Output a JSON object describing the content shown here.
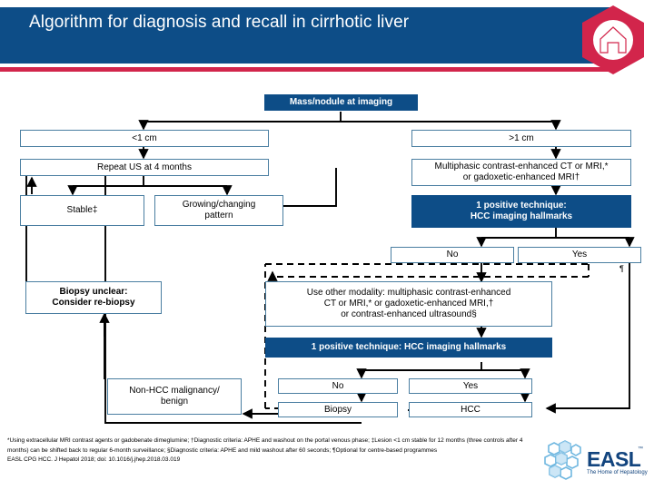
{
  "header": {
    "title": "Algorithm for diagnosis and recall in cirrhotic liver",
    "bar_color": "#0d4d87",
    "accent_color": "#d2254b",
    "logo_icon": "easl-hexagon-house-icon"
  },
  "chart_data": {
    "type": "diagram",
    "title": "Algorithm for diagnosis and recall in cirrhotic liver",
    "nodes": [
      {
        "id": "mass",
        "label": "Mass/nodule at imaging",
        "style": "dark"
      },
      {
        "id": "lt1cm",
        "label": "<1 cm",
        "style": "plain"
      },
      {
        "id": "gt1cm",
        "label": ">1 cm",
        "style": "plain"
      },
      {
        "id": "repeat_us",
        "label": "Repeat US at 4 months",
        "style": "plain"
      },
      {
        "id": "multiphasic",
        "label": "Multiphasic contrast-enhanced CT or MRI,* or gadoxetic-enhanced MRI†",
        "style": "plain"
      },
      {
        "id": "stable",
        "label": "Stable‡",
        "style": "plain"
      },
      {
        "id": "growing",
        "label": "Growing/changing pattern",
        "style": "plain"
      },
      {
        "id": "pos1",
        "label": "1 positive technique: HCC imaging hallmarks",
        "style": "dark"
      },
      {
        "id": "no1",
        "label": "No",
        "style": "plain"
      },
      {
        "id": "yes1",
        "label": "Yes",
        "style": "plain"
      },
      {
        "id": "biopsy_unclear",
        "label": "Biopsy unclear: Consider re-biopsy",
        "style": "bold"
      },
      {
        "id": "other_modality",
        "label": "Use other modality: multiphasic contrast-enhanced CT or MRI,* or gadoxetic-enhanced MRI,† or contrast-enhanced ultrasound§",
        "style": "plain"
      },
      {
        "id": "pos2",
        "label": "1 positive technique: HCC imaging hallmarks",
        "style": "dark"
      },
      {
        "id": "nonhcc",
        "label": "Non-HCC malignancy/ benign",
        "style": "plain"
      },
      {
        "id": "no2",
        "label": "No",
        "style": "plain"
      },
      {
        "id": "yes2",
        "label": "Yes",
        "style": "plain"
      },
      {
        "id": "biopsy",
        "label": "Biopsy",
        "style": "plain"
      },
      {
        "id": "hcc",
        "label": "HCC",
        "style": "plain"
      }
    ],
    "edges": [
      {
        "from": "mass",
        "to": "lt1cm",
        "style": "solid"
      },
      {
        "from": "mass",
        "to": "gt1cm",
        "style": "solid"
      },
      {
        "from": "lt1cm",
        "to": "repeat_us",
        "style": "solid"
      },
      {
        "from": "gt1cm",
        "to": "multiphasic",
        "style": "solid"
      },
      {
        "from": "repeat_us",
        "to": "stable",
        "style": "solid"
      },
      {
        "from": "repeat_us",
        "to": "growing",
        "style": "solid"
      },
      {
        "from": "stable",
        "to": "repeat_us",
        "style": "solid"
      },
      {
        "from": "growing",
        "to": "multiphasic",
        "style": "solid"
      },
      {
        "from": "multiphasic",
        "to": "pos1",
        "style": "solid"
      },
      {
        "from": "pos1",
        "to": "no1",
        "style": "solid"
      },
      {
        "from": "pos1",
        "to": "yes1",
        "style": "solid"
      },
      {
        "from": "no1",
        "to": "other_modality",
        "style": "solid"
      },
      {
        "from": "other_modality",
        "to": "pos2",
        "style": "solid"
      },
      {
        "from": "pos2",
        "to": "no2",
        "style": "solid"
      },
      {
        "from": "pos2",
        "to": "yes2",
        "style": "solid"
      },
      {
        "from": "no2",
        "to": "biopsy",
        "style": "solid"
      },
      {
        "from": "biopsy",
        "to": "hcc",
        "style": "solid"
      },
      {
        "from": "biopsy",
        "to": "nonhcc",
        "style": "solid"
      },
      {
        "from": "yes2",
        "to": "hcc",
        "style": "solid"
      },
      {
        "from": "yes1",
        "to": "hcc",
        "style": "solid"
      },
      {
        "from": "nonhcc",
        "to": "biopsy_unclear",
        "style": "solid"
      },
      {
        "from": "biopsy_unclear",
        "to": "repeat_us",
        "style": "solid"
      },
      {
        "from": "biopsy",
        "to": "other_modality",
        "style": "dashed"
      }
    ]
  },
  "nodes": {
    "mass": "Mass/nodule at imaging",
    "lt1cm": "<1 cm",
    "gt1cm": ">1 cm",
    "repeat_us": "Repeat US at 4 months",
    "multiphasic_line1": "Multiphasic contrast-enhanced CT or MRI,*",
    "multiphasic_line2": "or gadoxetic-enhanced MRI†",
    "stable": "Stable‡",
    "growing_line1": "Growing/changing",
    "growing_line2": "pattern",
    "pos1_line1": "1 positive technique:",
    "pos1_line2": "HCC imaging hallmarks",
    "no1": "No",
    "yes1": "Yes",
    "yes1_marker": "¶",
    "biopsy_unclear_line1": "Biopsy unclear:",
    "biopsy_unclear_line2": "Consider re-biopsy",
    "other_modality_line1": "Use other modality: multiphasic contrast-enhanced",
    "other_modality_line2": "CT or MRI,* or gadoxetic-enhanced MRI,†",
    "other_modality_line3": "or contrast-enhanced ultrasound§",
    "pos2": "1 positive technique: HCC imaging hallmarks",
    "nonhcc_line1": "Non-HCC malignancy/",
    "nonhcc_line2": "benign",
    "no2": "No",
    "yes2": "Yes",
    "biopsy": "Biopsy",
    "hcc": "HCC"
  },
  "footnotes": {
    "text": "*Using extracellular MRI contrast agents or gadobenate dimeglumine; †Diagnostic criteria: APHE and washout on the portal venous phase; ‡Lesion <1 cm stable for 12 months (three controls after 4 months) can be shifted back to regular 6-month surveillance; §Diagnostic criteria: APHE and mild washout after 60 seconds; ¶Optional for centre-based programmes",
    "citation": "EASL CPG HCC. J Hepatol 2018; doi: 10.1016/j.jhep.2018.03.019"
  },
  "easl_logo": {
    "wordmark": "EASL",
    "tm": "™",
    "tagline": "The Home of Hepatology",
    "color": "#12447e"
  }
}
